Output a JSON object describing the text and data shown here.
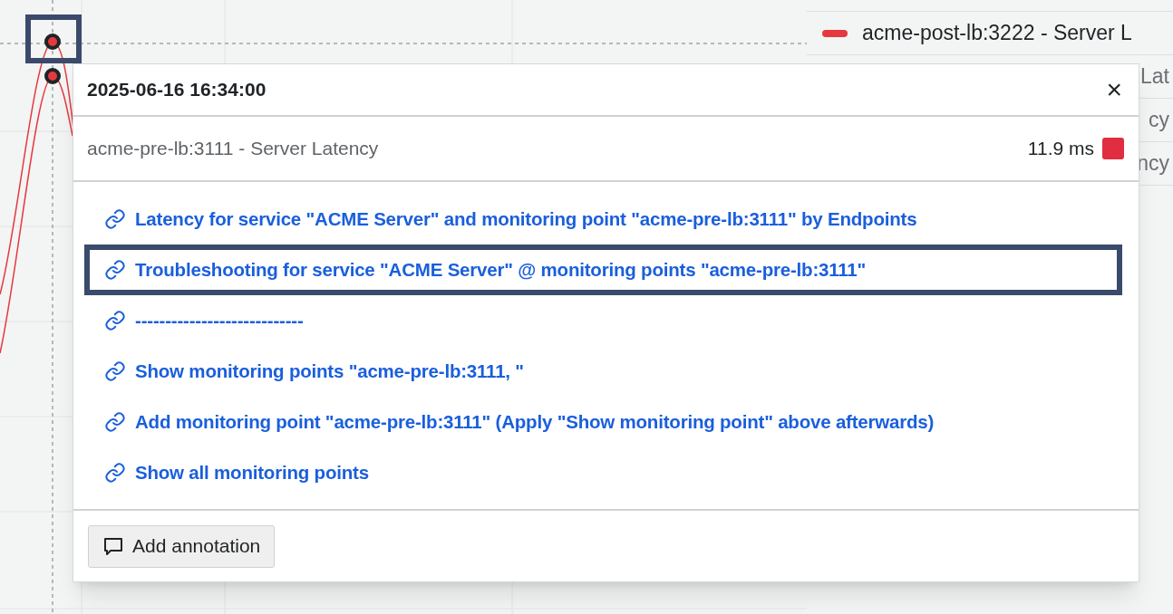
{
  "chart": {
    "point_highlighted": true
  },
  "legend": [
    {
      "kind": "full",
      "text": "acme-post-lb:3222 - Server L",
      "color": "#e5393f"
    },
    {
      "kind": "fragment",
      "text": "Lat"
    },
    {
      "kind": "fragment",
      "text": "cy"
    },
    {
      "kind": "fragment",
      "text": "ncy"
    }
  ],
  "popup": {
    "timestamp": "2025-06-16 16:34:00",
    "close": "×",
    "series": {
      "name": "acme-pre-lb:3111 - Server Latency",
      "value": "11.9 ms",
      "color": "#e02d40"
    },
    "links": [
      {
        "label": "Latency for service \"ACME Server\" and monitoring point \"acme-pre-lb:3111\" by Endpoints",
        "highlighted": false
      },
      {
        "label": "Troubleshooting for service \"ACME Server\" @ monitoring points \"acme-pre-lb:3111\"",
        "highlighted": true
      },
      {
        "label": "----------------------------",
        "highlighted": false
      },
      {
        "label": "Show monitoring points \"acme-pre-lb:3111, \"",
        "highlighted": false
      },
      {
        "label": "Add monitoring point \"acme-pre-lb:3111\" (Apply \"Show monitoring point\" above afterwards)",
        "highlighted": false
      },
      {
        "label": "Show all monitoring points",
        "highlighted": false
      }
    ],
    "annotate_button": "Add annotation"
  }
}
